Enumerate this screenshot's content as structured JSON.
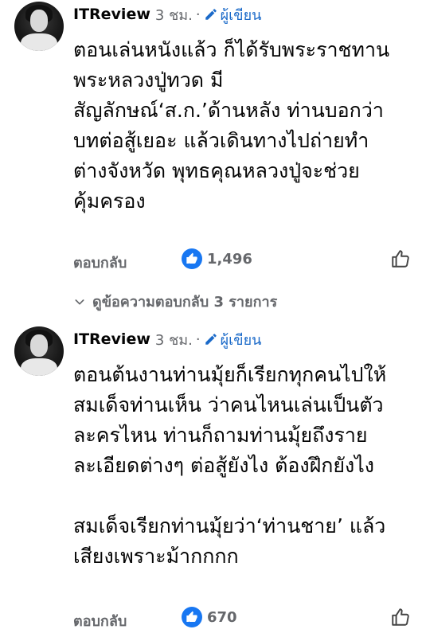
{
  "comments": [
    {
      "author": "ITReview",
      "time": "3 ชม.",
      "separator": "·",
      "badge": "ผู้เขียน",
      "text": "ตอนเล่นหนังแล้ว ก็ได้รับพระราชทาน\nพระหลวงปู่ทวด มี\nสัญลักษณ์‘ส.ก.’ด้านหลัง ท่านบอกว่า\nบทต่อสู้เยอะ แล้วเดินทางไปถ่ายทำ\nต่างจังหวัด พุทธคุณหลวงปู่จะช่วย\nคุ้มครอง",
      "reply_label": "ตอบกลับ",
      "reactions": "1,496"
    },
    {
      "author": "ITReview",
      "time": "3 ชม.",
      "separator": "·",
      "badge": "ผู้เขียน",
      "text": "ตอนต้นงานท่านมุ้ยก็เรียกทุกคนไปให้\nสมเด็จท่านเห็น ว่าคนไหนเล่นเป็นตัว\nละครไหน ท่านก็ถามท่านมุ้ยถึงราย\nละเอียดต่างๆ ต่อสู้ยังไง ต้องฝึกยังไง\n\nสมเด็จเรียกท่านมุ้ยว่า‘ท่านชาย’ แล้ว\nเสียงเพราะม้ากกกก",
      "reply_label": "ตอบกลับ",
      "reactions": "670"
    }
  ],
  "view_replies": "ดูข้อความตอบกลับ 3 รายการ",
  "colors": {
    "like": "#1877f2",
    "badge": "#1b6ac9",
    "secondary": "#65676b"
  },
  "icons": [
    "pencil-icon",
    "like-icon",
    "thumbs-up-outline-icon",
    "chevron-down-icon"
  ]
}
